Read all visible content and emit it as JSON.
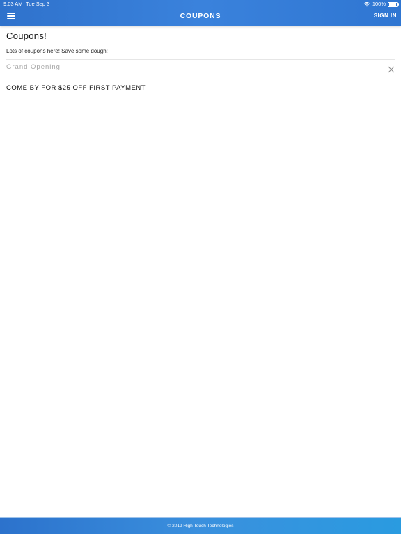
{
  "status_bar": {
    "time": "9:03 AM",
    "date": "Tue Sep 3",
    "battery": "100%"
  },
  "header": {
    "title": "COUPONS",
    "sign_in_label": "SIGN IN",
    "menu_icon": "hamburger-menu-icon"
  },
  "page": {
    "title": "Coupons!",
    "subtitle": "Lots of coupons here! Save some dough!"
  },
  "coupons": [
    {
      "title": "Grand Opening",
      "body": "COME BY FOR $25 OFF FIRST PAYMENT"
    }
  ],
  "footer": {
    "copyright": "© 2019 High Touch Technologies"
  },
  "colors": {
    "header_bg": "#3a82dc",
    "footer_bg": "#3a90de",
    "muted_text": "#a7a7a7"
  }
}
